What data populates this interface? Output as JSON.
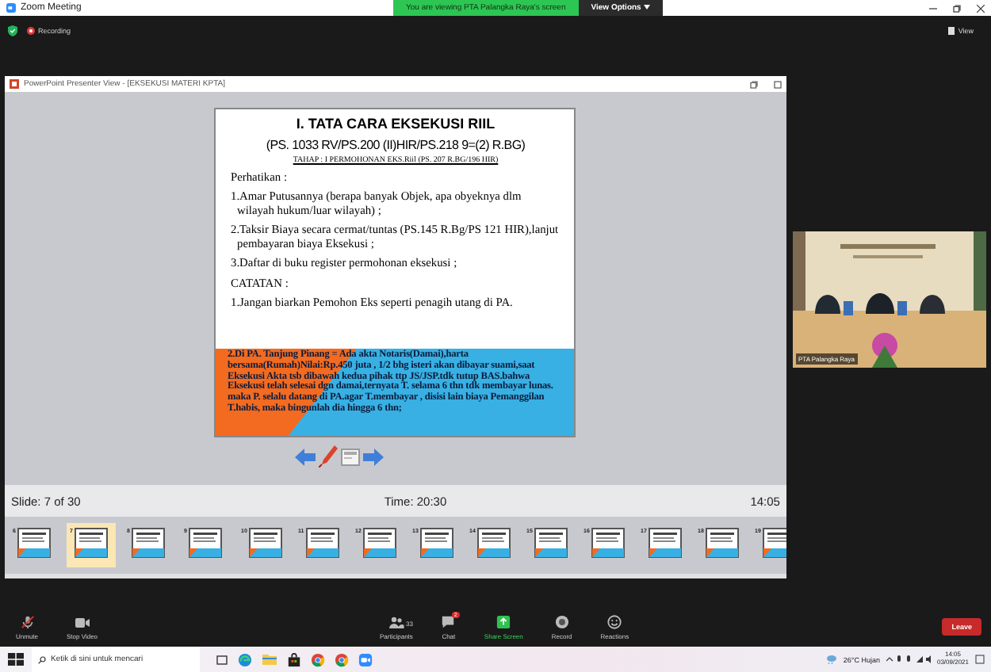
{
  "window": {
    "title": "Zoom Meeting"
  },
  "share_banner": {
    "text": "You are viewing PTA Palangka Raya's screen",
    "view_options": "View Options"
  },
  "meeting_bar": {
    "recording": "Recording",
    "view": "View"
  },
  "presenter": {
    "title": "PowerPoint Presenter View - [EKSEKUSI MATERI KPTA]",
    "slide": {
      "title": "I. TATA CARA EKSEKUSI RIIL",
      "subtitle": "(PS. 1033 RV/PS.200 (II)HIR/PS.218 9=(2) R.BG)",
      "stage": "TAHAP : I  PERMOHONAN EKS.Riil  (PS. 207 R.BG/196 HIR)",
      "heading": "Perhatikan :",
      "items": [
        "1.Amar Putusannya (berapa  banyak Objek, apa obyeknya dlm wilayah hukum/luar wilayah) ;",
        "2.Taksir Biaya secara cermat/tuntas (PS.145 R.Bg/PS  121 HIR),lanjut pembayaran biaya Eksekusi ;",
        "3.Daftar di buku register permohonan eksekusi ;"
      ],
      "notes_heading": "CATATAN :",
      "note": "1.Jangan biarkan Pemohon Eks seperti penagih utang di  PA.",
      "highlight_note": "2.Di PA. Tanjung Pinang = Ada akta Notaris(Damai),harta bersama(Rumah)Nilai:Rp.450 juta , 1/2 bhg isteri akan dibayar suami,saat Eksekusi Akta tsb dibawah kedua pihak ttp JS/JSP.tdk tutup BAS.bahwa Eksekusi telah selesai dgn damai,ternyata T. selama 6 thn tdk membayar lunas. maka P. selalu datang di PA.agar T.membayar , disisi lain biaya Pemanggilan T.habis, maka bingunlah dia hingga 6 thn;"
    },
    "status": {
      "slide": "Slide: 7 of 30",
      "time": "Time: 20:30",
      "clock": "14:05"
    },
    "thumbnails": [
      {
        "number": "6",
        "selected": false
      },
      {
        "number": "7",
        "selected": true
      },
      {
        "number": "8",
        "selected": false
      },
      {
        "number": "9",
        "selected": false
      },
      {
        "number": "10",
        "selected": false
      },
      {
        "number": "11",
        "selected": false
      },
      {
        "number": "12",
        "selected": false
      },
      {
        "number": "13",
        "selected": false
      },
      {
        "number": "14",
        "selected": false
      },
      {
        "number": "15",
        "selected": false
      },
      {
        "number": "16",
        "selected": false
      },
      {
        "number": "17",
        "selected": false
      },
      {
        "number": "18",
        "selected": false
      },
      {
        "number": "19",
        "selected": false
      }
    ]
  },
  "video": {
    "name": "PTA Palangka Raya"
  },
  "toolbar_left": [
    {
      "kind": "mic",
      "label": "Unmute"
    },
    {
      "kind": "video",
      "label": "Stop Video"
    }
  ],
  "toolbar_center": [
    {
      "kind": "participants",
      "label": "Participants",
      "count": "33"
    },
    {
      "kind": "chat",
      "label": "Chat",
      "badge": "2"
    },
    {
      "kind": "share",
      "label": "Share Screen"
    },
    {
      "kind": "record",
      "label": "Record"
    },
    {
      "kind": "reactions",
      "label": "Reactions"
    }
  ],
  "leave": "Leave",
  "taskbar": {
    "search_placeholder": "Ketik di sini untuk mencari",
    "apps": [
      {
        "kind": "edge"
      },
      {
        "kind": "folder"
      },
      {
        "kind": "store"
      },
      {
        "kind": "chrome"
      },
      {
        "kind": "chrome"
      },
      {
        "kind": "zoom"
      }
    ],
    "weather": "26°C Hujan",
    "time": "14:05",
    "date": "03/09/2021"
  }
}
